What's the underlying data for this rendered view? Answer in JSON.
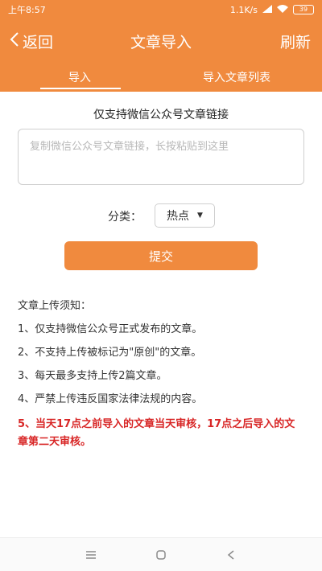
{
  "status": {
    "time": "上午8:57",
    "network_speed": "1.1K/s",
    "battery": "39"
  },
  "header": {
    "back_label": "返回",
    "title": "文章导入",
    "refresh_label": "刷新"
  },
  "tabs": [
    {
      "label": "导入",
      "active": true
    },
    {
      "label": "导入文章列表",
      "active": false
    }
  ],
  "form": {
    "support_note": "仅支持微信公众号文章链接",
    "link_placeholder": "复制微信公众号文章链接，长按粘贴到这里",
    "category_label": "分类：",
    "category_selected": "热点",
    "submit_label": "提交"
  },
  "notice": {
    "heading": "文章上传须知：",
    "items": [
      "1、仅支持微信公众号正式发布的文章。",
      "2、不支持上传被标记为\"原创\"的文章。",
      "3、每天最多支持上传2篇文章。",
      "4、严禁上传违反国家法律法规的内容。"
    ],
    "warning": "5、当天17点之前导入的文章当天审核，17点之后导入的文章第二天审核。"
  },
  "colors": {
    "accent": "#f08a3e",
    "warning": "#d82626"
  }
}
